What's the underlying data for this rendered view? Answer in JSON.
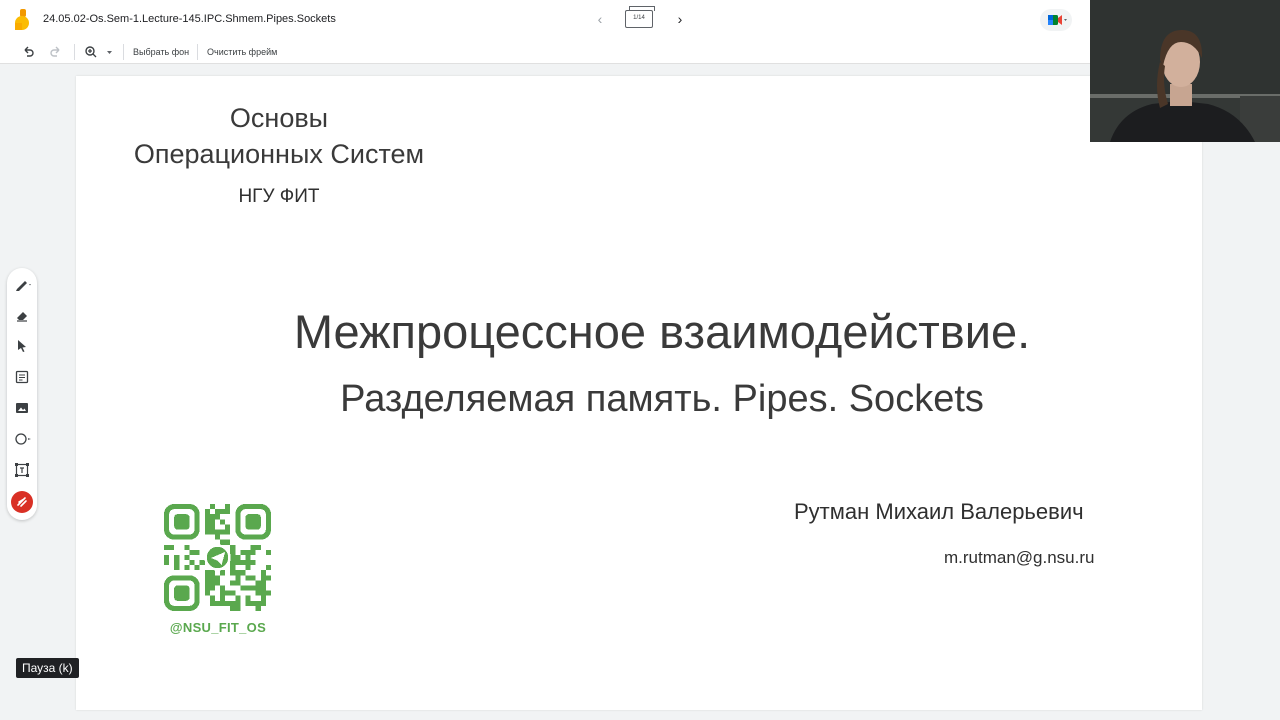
{
  "app": {
    "logo_icon": "jamboard-logo-icon",
    "title": "24.05.02-Os.Sem-1.Lecture-145.IPC.Shmem.Pipes.Sockets"
  },
  "frame_nav": {
    "prev_icon": "chevron-left-icon",
    "counter": "1/14",
    "next_icon": "chevron-right-icon"
  },
  "meet_button": {
    "icon": "google-meet-icon"
  },
  "toolbar": {
    "undo_icon": "undo-icon",
    "redo_icon": "redo-icon",
    "zoom_icon": "zoom-icon",
    "set_background": "Выбрать фон",
    "clear_frame": "Очистить фрейм"
  },
  "slide": {
    "course_title_line1": "Основы",
    "course_title_line2": "Операционных Систем",
    "org": "НГУ ФИТ",
    "main_title": "Межпроцессное взаимодействие.",
    "sub_title": "Разделяемая память. Pipes. Sockets",
    "author": "Рутман Михаил Валерьевич",
    "email": "m.rutman@g.nsu.ru",
    "qr_handle": "@NSU_FIT_OS",
    "qr_color": "#5aa84e"
  },
  "tools": [
    "pen-icon",
    "eraser-icon",
    "select-icon",
    "sticky-note-icon",
    "image-icon",
    "circle-icon",
    "text-box-icon",
    "laser-icon"
  ],
  "tooltip": "Пауза (k)"
}
